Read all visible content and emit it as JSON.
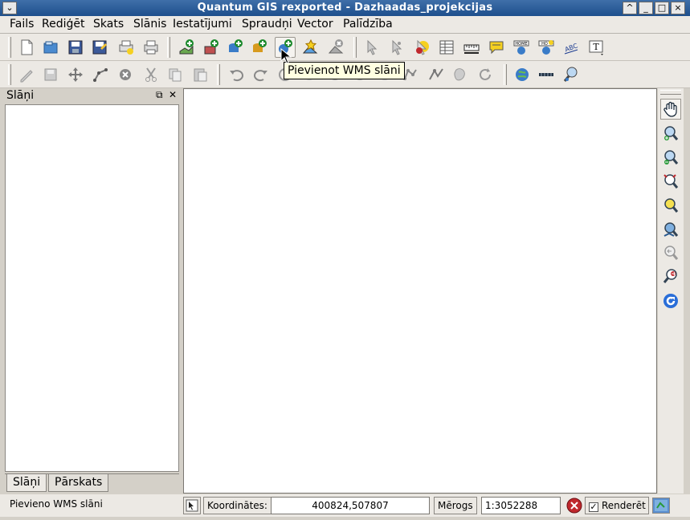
{
  "window": {
    "title": "Quantum GIS rexported - Dazhaadas_projekcijas",
    "controls": [
      "menu-icon",
      "collapse-icon",
      "minimize-icon",
      "maximize-icon",
      "close-icon"
    ]
  },
  "menu": [
    {
      "label": "Fails"
    },
    {
      "label": "Rediģēt"
    },
    {
      "label": "Skats"
    },
    {
      "label": "Slānis"
    },
    {
      "label": "Iestatījumi"
    },
    {
      "label": "Spraudņi"
    },
    {
      "label": "Vector"
    },
    {
      "label": "Palīdzība"
    }
  ],
  "toolbar1": {
    "icons": [
      "new-project-icon",
      "open-project-icon",
      "save-project-icon",
      "save-as-icon",
      "print-composer-icon",
      "print-icon",
      "add-vector-layer-icon",
      "add-raster-layer-icon",
      "add-postgis-layer-icon",
      "add-spatialite-layer-icon",
      "add-wms-layer-icon",
      "new-vector-layer-icon",
      "remove-layer-icon",
      "identify-icon",
      "select-icon",
      "deselect-icon",
      "attribute-table-icon",
      "measure-icon",
      "map-tips-icon",
      "spatial-bookmark-home-icon",
      "new-bookmark-icon",
      "label-icon",
      "text-annotation-icon"
    ]
  },
  "toolbar2": {
    "icons": [
      "toggle-editing-icon",
      "save-edits-icon",
      "move-feature-icon",
      "node-tool-icon",
      "delete-selected-icon",
      "cut-features-icon",
      "copy-features-icon",
      "paste-features-icon",
      "undo-icon",
      "redo-icon",
      "simplify-icon",
      "add-ring-icon",
      "add-island-icon",
      "delete-ring-icon",
      "delete-part-icon",
      "reshape-icon",
      "split-icon",
      "merge-icon",
      "node-add-icon",
      "rotate-point-icon",
      "georeferencer-icon",
      "measure-line-icon",
      "search-zoom-icon"
    ]
  },
  "tooltip": "Pievienot WMS slāni",
  "layers_panel": {
    "title": "Slāņi",
    "tabs": [
      "Slāņi",
      "Pārskats"
    ],
    "active_tab": "Slāņi"
  },
  "map_navigation": {
    "icons": [
      "pan-icon",
      "zoom-in-icon",
      "zoom-out-icon",
      "zoom-full-icon",
      "zoom-to-selection-icon",
      "zoom-to-layer-icon",
      "zoom-last-icon",
      "zoom-next-icon",
      "refresh-icon"
    ]
  },
  "statusbar": {
    "message": "Pievieno WMS slāni",
    "coordinates_label": "Koordinātes:",
    "coordinates_value": "400824,507807",
    "scale_label": "Mērogs",
    "scale_value": "1:3052288",
    "render_label": "Renderēt",
    "render_checked": true
  },
  "colors": {
    "titlebar": "#2b5b99",
    "chrome": "#ece9e4",
    "tooltip_bg": "#ffffe1",
    "stop_render": "#c0282d"
  }
}
